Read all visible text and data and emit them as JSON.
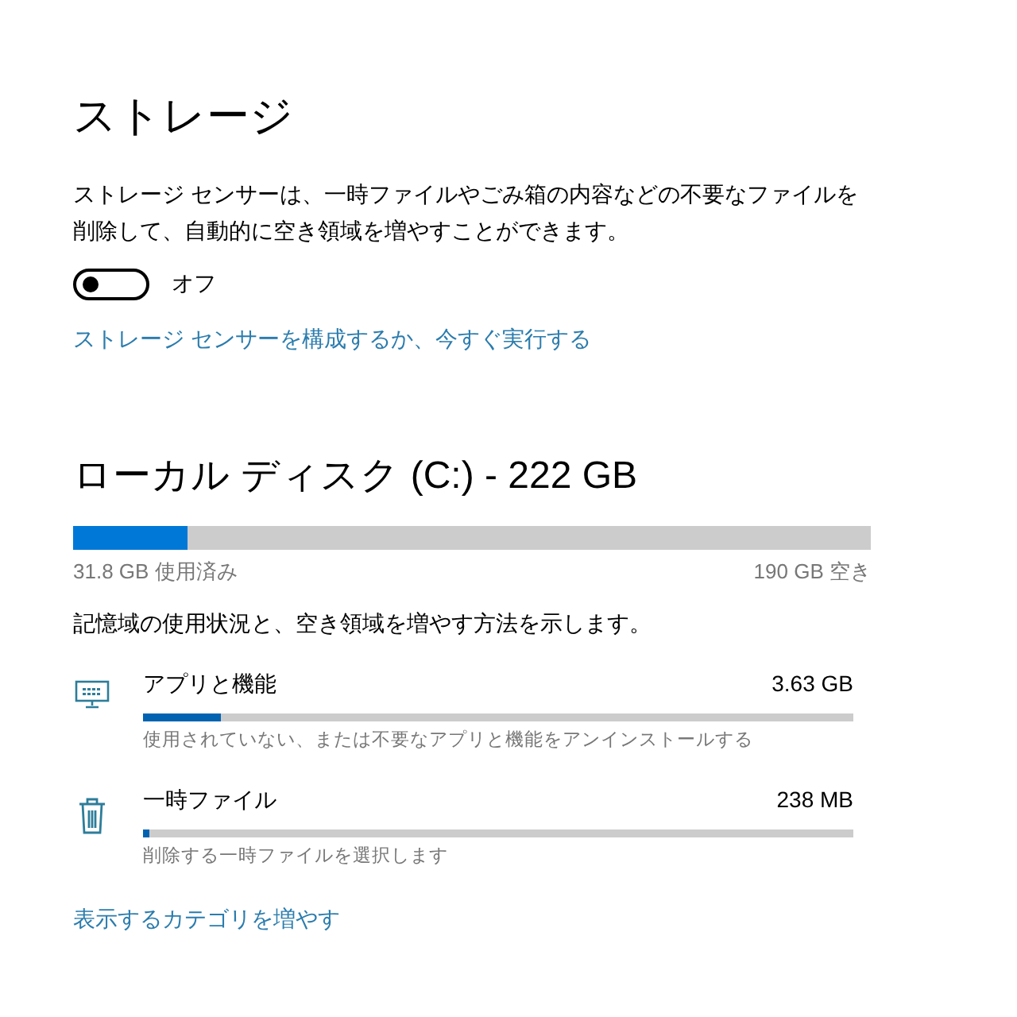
{
  "title": "ストレージ",
  "description": "ストレージ センサーは、一時ファイルやごみ箱の内容などの不要なファイルを削除して、自動的に空き領域を増やすことができます。",
  "toggle": {
    "on": false,
    "label": "オフ"
  },
  "configure_link": "ストレージ センサーを構成するか、今すぐ実行する",
  "disk": {
    "title": "ローカル ディスク (C:) - 222 GB",
    "level": 0.143,
    "used": "31.8 GB 使用済み",
    "free": "190 GB 空き"
  },
  "usage_text": "記憶域の使用状況と、空き領域を増やす方法を示します。",
  "categories": [
    {
      "kind": "apps",
      "name": "アプリと機能",
      "size": "3.63 GB",
      "level": 0.11,
      "hint": "使用されていない、または不要なアプリと機能をアンインストールする"
    },
    {
      "kind": "temp",
      "name": "一時ファイル",
      "size": "238 MB",
      "level": 0.01,
      "hint": "削除する一時ファイルを選択します"
    }
  ],
  "more_link": "表示するカテゴリを増やす"
}
